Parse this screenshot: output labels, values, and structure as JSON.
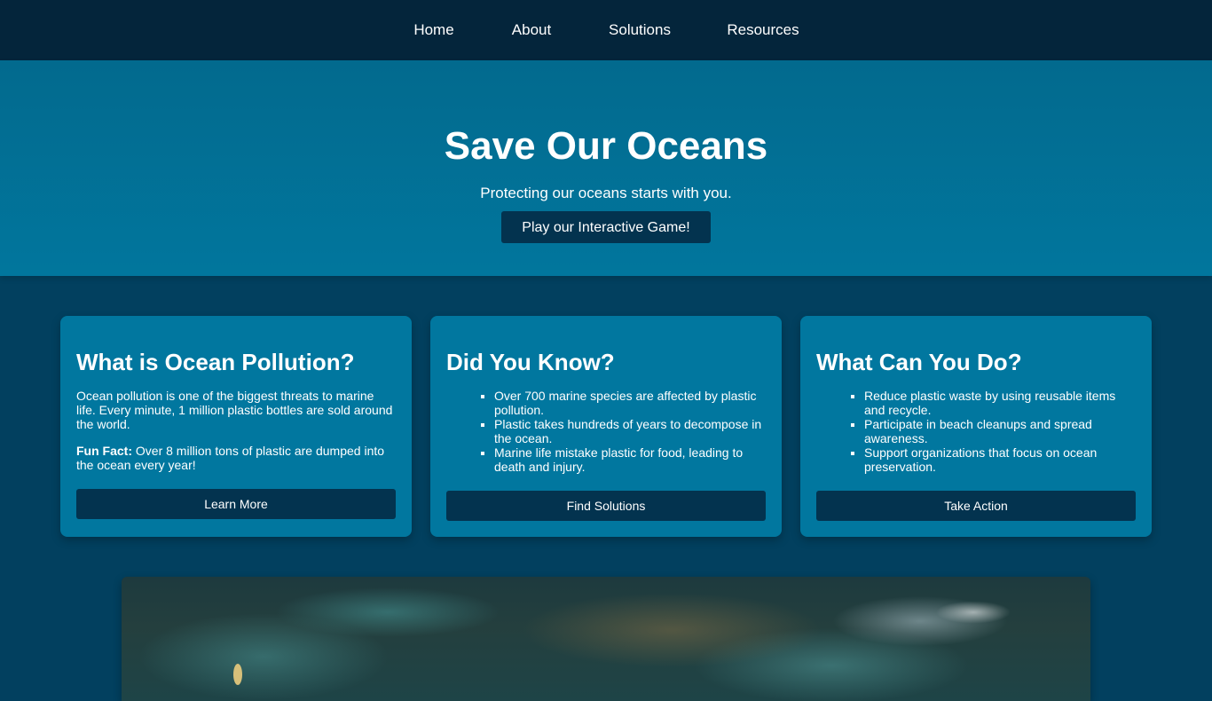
{
  "nav": {
    "items": [
      {
        "label": "Home"
      },
      {
        "label": "About"
      },
      {
        "label": "Solutions"
      },
      {
        "label": "Resources"
      }
    ]
  },
  "hero": {
    "title": "Save Our Oceans",
    "subtitle": "Protecting our oceans starts with you.",
    "button_label": "Play our Interactive Game!"
  },
  "cards": [
    {
      "title": "What is Ocean Pollution?",
      "paragraph": "Ocean pollution is one of the biggest threats to marine life. Every minute, 1 million plastic bottles are sold around the world.",
      "fact_label": "Fun Fact:",
      "fact_text": " Over 8 million tons of plastic are dumped into the ocean every year!",
      "button_label": "Learn More"
    },
    {
      "title": "Did You Know?",
      "items": [
        "Over 700 marine species are affected by plastic pollution.",
        "Plastic takes hundreds of years to decompose in the ocean.",
        "Marine life mistake plastic for food, leading to death and injury."
      ],
      "button_label": "Find Solutions"
    },
    {
      "title": "What Can You Do?",
      "items": [
        "Reduce plastic waste by using reusable items and recycle.",
        "Participate in beach cleanups and spread awareness.",
        "Support organizations that focus on ocean preservation."
      ],
      "button_label": "Take Action"
    }
  ],
  "colors": {
    "nav_bg": "#04253b",
    "hero_bg": "#026a8e",
    "page_bg": "#02405f",
    "card_bg": "#01779f",
    "button_bg": "#03334f"
  }
}
